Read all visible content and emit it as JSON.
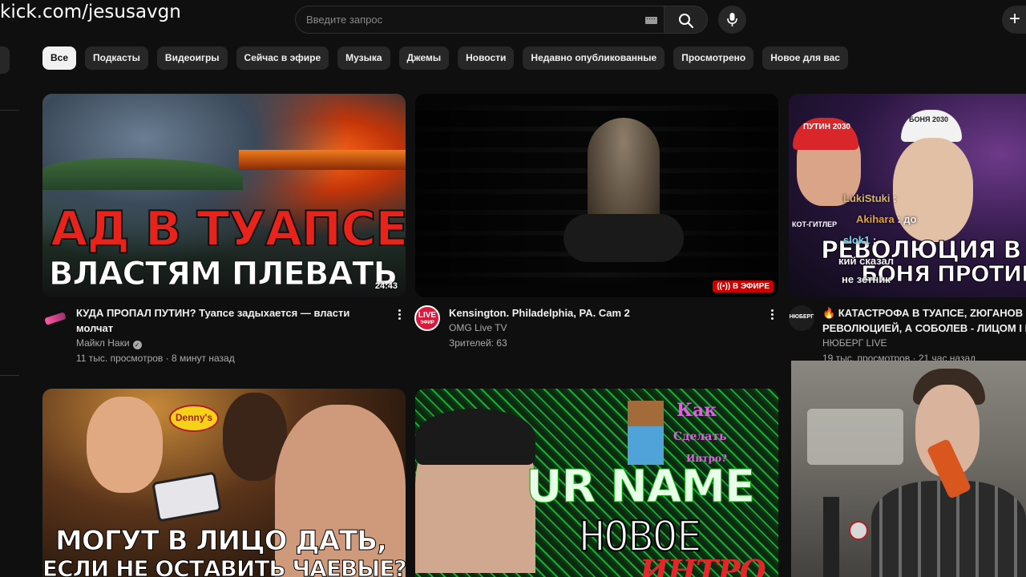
{
  "stream_overlay": {
    "url": "kick.com/jesusavgn"
  },
  "header": {
    "search_placeholder": "Введите запрос",
    "icons": {
      "keyboard": "keyboard-icon",
      "search": "search-icon",
      "mic": "mic-icon",
      "create": "plus-icon"
    },
    "create_glyph": "+"
  },
  "chips": [
    {
      "label": "Все",
      "active": true
    },
    {
      "label": "Подкасты"
    },
    {
      "label": "Видеоигры"
    },
    {
      "label": "Сейчас в эфире"
    },
    {
      "label": "Музыка"
    },
    {
      "label": "Джемы"
    },
    {
      "label": "Новости"
    },
    {
      "label": "Недавно опубликованные"
    },
    {
      "label": "Просмотрено"
    },
    {
      "label": "Новое для вас"
    }
  ],
  "videos": [
    {
      "title": "КУДА ПРОПАЛ ПУТИН? Туапсе задыхается — власти молчат",
      "channel": "Майкл Наки",
      "verified_glyph": "✓",
      "stats": "11 тыс. просмотров · 8 минут назад",
      "duration": "24:43",
      "thumb_text": {
        "line1": "АД В ТУАПСЕ",
        "line2": "ВЛАСТЯМ ПЛЕВАТЬ"
      }
    },
    {
      "title": "Kensington. Philadelphia, PA. Cam 2",
      "channel": "OMG Live TV",
      "stats": "Зрителей: 63",
      "live_badge": "((•)) В ЭФИРЕ",
      "avatar_text": {
        "top": "LIVE",
        "bottom": "ЭФИР"
      }
    },
    {
      "title_line1": "🔥 КАТАСТРОФА В ТУАПСЕ, ZЮГАНОВ П",
      "title_line2": "РЕВОЛЮЦИЕЙ, А СОБОЛЕВ - ЛИЦОМ І М",
      "channel": "НЮБЕРГ LIVE",
      "stats": "19 тыс. просмотров · 21 час назад",
      "avatar_text": "НЮБЕРГ",
      "thumb_text": {
        "line1": "РЕВОЛЮЦИЯ В Р",
        "line2": "БОНЯ ПРОТИВ Б",
        "cap_left": "ПУТИН 2030",
        "cap_right": "БОНЯ 2030",
        "tag": "КОТ-ГИТЛЕР"
      }
    },
    {
      "thumb_text": {
        "sign": "Denny's",
        "line1": "МОГУТ В ЛИЦО ДАТЬ,",
        "line2": "ЕСЛИ НЕ ОСТАВИТЬ ЧАЕВЫЕ?"
      }
    },
    {
      "thumb_text": {
        "name": "UR NAME",
        "line1": "НОВОЕ",
        "line2": "ИНТРО",
        "q1": "Как",
        "q2": "Сделать",
        "q3": "Интро?"
      }
    }
  ],
  "chat_overlay": [
    {
      "user": "LukiStuki",
      "text": ":"
    },
    {
      "user": "Akihara",
      "text": ": до"
    },
    {
      "user": "slok1",
      "text": ":"
    },
    {
      "user": "",
      "text": "кий сказал"
    },
    {
      "user": "",
      "text": "не зетник"
    }
  ]
}
